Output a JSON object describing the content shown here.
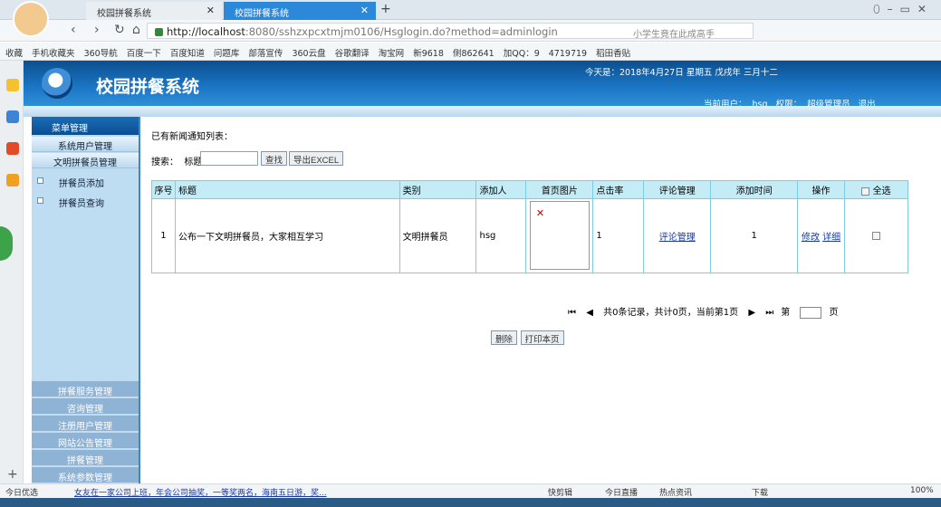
{
  "browser": {
    "tabs": [
      {
        "label": "校园拼餐系统"
      },
      {
        "label": "校园拼餐系统"
      }
    ],
    "url_host": "http://localhost",
    "url_rest": ":8080/sshzxpcxtmjm0106/Hsglogin.do?method=adminlogin",
    "search_hint": "小学生竟在此成高手",
    "bookmarks": [
      "收藏",
      "手机收藏夹",
      "360导航",
      "百度一下",
      "百度知道",
      "问题库",
      "部落宣传",
      "360云盘",
      "谷歌翻译",
      "淘宝网",
      "新9618",
      "侧862641",
      "加QQ：9",
      "4719719",
      "稻田香贴"
    ]
  },
  "app": {
    "title": "校园拼餐系统",
    "today": "今天是：2018年4月27日 星期五 戊戌年 三月十二",
    "current_user_label": "当前用户：",
    "current_user": "hsg",
    "role_label": "权限：",
    "role": "超级管理员",
    "logout": "退出"
  },
  "sidebar": {
    "header": "菜单管理",
    "items": [
      "系统用户管理",
      "文明拼餐员管理"
    ],
    "subitems": [
      "拼餐员添加",
      "拼餐员查询"
    ],
    "bottom": [
      "拼餐服务管理",
      "咨询管理",
      "注册用户管理",
      "网站公告管理",
      "拼餐管理",
      "系统参数管理"
    ]
  },
  "main": {
    "list_title": "已有新闻通知列表：",
    "search_label": "搜索：",
    "title_label": "标题：",
    "search_value": "",
    "search_button": "查找",
    "export_button": "导出EXCEL",
    "columns": [
      "序号",
      "标题",
      "类别",
      "添加人",
      "首页图片",
      "点击率",
      "评论管理",
      "添加时间",
      "操作",
      "全选"
    ],
    "rows": [
      {
        "no": "1",
        "title": "公布一下文明拼餐员，大家相互学习",
        "category": "文明拼餐员",
        "adder": "hsg",
        "clicks": "1",
        "comment": "评论管理",
        "time": "1",
        "edit": "修改",
        "detail": "详细"
      }
    ],
    "pager": {
      "first": "⏮",
      "prev": "◀",
      "info": "共0条记录，共计0页，当前第1页",
      "next": "▶",
      "last": "⏭",
      "di": "第",
      "page": "页"
    },
    "delete_button": "删除",
    "print_button": "打印本页"
  },
  "status": {
    "left1": "今日优选",
    "news": "女友在一家公司上班，年会公司抽奖，一等奖两名，海南五日游，奖...",
    "right": [
      "快剪辑",
      "今日直播",
      "热点资讯",
      "下载"
    ],
    "zoom": "100%"
  }
}
